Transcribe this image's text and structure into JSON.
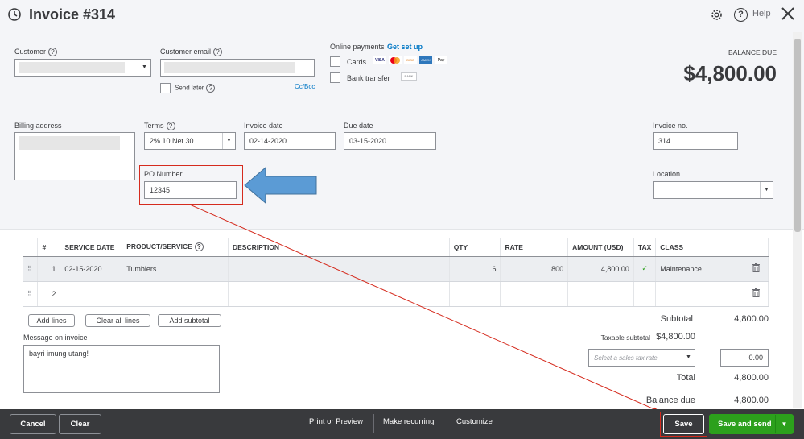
{
  "header": {
    "title": "Invoice #314",
    "help_label": "Help"
  },
  "customer": {
    "label": "Customer",
    "value": ""
  },
  "customer_email": {
    "label": "Customer email",
    "value": "",
    "send_later_label": "Send later",
    "cc_bcc_label": "Cc/Bcc"
  },
  "online_payments": {
    "label": "Online payments",
    "get_set_up": "Get set up",
    "cards_label": "Cards",
    "bank_label": "Bank transfer",
    "bank_badge": "BANK",
    "card_brands": [
      "VISA",
      "MC",
      "DISC",
      "AMEX",
      "Pay"
    ]
  },
  "balance": {
    "label": "BALANCE DUE",
    "amount": "$4,800.00"
  },
  "billing_address": {
    "label": "Billing address",
    "value": ""
  },
  "terms": {
    "label": "Terms",
    "value": "2% 10 Net 30"
  },
  "invoice_date": {
    "label": "Invoice date",
    "value": "02-14-2020"
  },
  "due_date": {
    "label": "Due date",
    "value": "03-15-2020"
  },
  "invoice_no": {
    "label": "Invoice no.",
    "value": "314"
  },
  "po_number": {
    "label": "PO Number",
    "value": "12345"
  },
  "location": {
    "label": "Location",
    "value": ""
  },
  "table": {
    "columns": [
      "#",
      "SERVICE DATE",
      "PRODUCT/SERVICE",
      "DESCRIPTION",
      "QTY",
      "RATE",
      "AMOUNT (USD)",
      "TAX",
      "CLASS"
    ],
    "rows": [
      {
        "num": "1",
        "service_date": "02-15-2020",
        "product": "Tumblers",
        "description": "",
        "qty": "6",
        "rate": "800",
        "amount": "4,800.00",
        "tax": "✓",
        "class": "Maintenance"
      },
      {
        "num": "2",
        "service_date": "",
        "product": "",
        "description": "",
        "qty": "",
        "rate": "",
        "amount": "",
        "tax": "",
        "class": ""
      }
    ]
  },
  "line_buttons": {
    "add_lines": "Add lines",
    "clear_all": "Clear all lines",
    "add_subtotal": "Add subtotal"
  },
  "message": {
    "label": "Message on invoice",
    "value": "bayri imung utang!"
  },
  "totals": {
    "subtotal_label": "Subtotal",
    "subtotal_value": "4,800.00",
    "taxable_label": "Taxable subtotal",
    "taxable_value": "$4,800.00",
    "tax_rate_placeholder": "Select a sales tax rate",
    "tax_value": "0.00",
    "total_label": "Total",
    "total_value": "4,800.00",
    "balance_due_label": "Balance due",
    "balance_due_value": "4,800.00"
  },
  "footer": {
    "cancel": "Cancel",
    "clear": "Clear",
    "print_preview": "Print or Preview",
    "make_recurring": "Make recurring",
    "customize": "Customize",
    "save": "Save",
    "save_and_send": "Save and send"
  },
  "colors": {
    "accent_green": "#2ca01c",
    "link_blue": "#0077c5",
    "footer_bg": "#393a3d",
    "annotation_red": "#d52b1e",
    "arrow_blue": "#5b9bd5"
  }
}
